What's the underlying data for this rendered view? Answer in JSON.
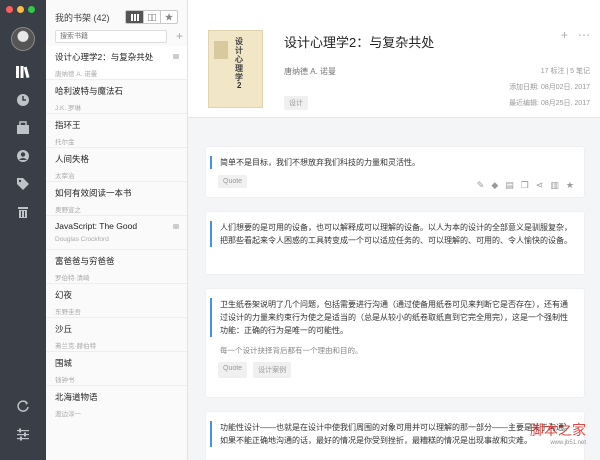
{
  "sidebar": {
    "shelf_title": "我的书架 (42)",
    "search_placeholder": "搜索书籍",
    "books": [
      {
        "title": "设计心理学2：与复杂共处",
        "author": "唐纳德 A. 诺曼",
        "has_note": true
      },
      {
        "title": "哈利波特与魔法石",
        "author": "J.K. 罗琳",
        "has_note": false
      },
      {
        "title": "指环王",
        "author": "托尔金",
        "has_note": false
      },
      {
        "title": "人间失格",
        "author": "太宰治",
        "has_note": false
      },
      {
        "title": "如何有效阅读一本书",
        "author": "奥野宣之",
        "has_note": false
      },
      {
        "title": "JavaScript: The Good",
        "author": "Douglas Crockford",
        "has_note": true
      },
      {
        "title": "富爸爸与穷爸爸",
        "author": "罗伯特·清崎",
        "has_note": false
      },
      {
        "title": "幻夜",
        "author": "东野圭吾",
        "has_note": false
      },
      {
        "title": "沙丘",
        "author": "弗兰克·赫伯特",
        "has_note": false
      },
      {
        "title": "围城",
        "author": "钱钟书",
        "has_note": false
      },
      {
        "title": "北海道物语",
        "author": "渡边淳一",
        "has_note": false
      }
    ]
  },
  "book": {
    "title": "设计心理学2：与复杂共处",
    "author": "唐纳德 A. 诺曼",
    "tag": "设计",
    "counts": "17 标注 | 5 笔记",
    "added": "添加日期: 08月02日, 2017",
    "updated": "最近编辑: 08月25日, 2017",
    "cover_title": "设计心理学",
    "cover_number": "2"
  },
  "quotes": [
    {
      "text": "简单不是目标，我们不想放弃我们科技的力量和灵活性。",
      "note": "",
      "tags": [
        "Quote"
      ]
    },
    {
      "text": "人们想要的是可用的设备，也可以解释成可以理解的设备。以人为本的设计的全部意义是驯服复杂，把那些看起来令人困惑的工具转变成一个可以适应任务的、可以理解的、可用的、令人愉快的设备。",
      "note": "",
      "tags": []
    },
    {
      "text": "卫生纸卷架说明了几个问题，包括需要进行沟通（通过使备用纸卷可见来判断它是否存在），还有通过设计的力量来约束行为使之是适当的（总是从较小的纸卷取纸直到它完全用完），这是一个强制性功能：正确的行为是唯一的可能性。",
      "note": "每一个设计抉择背后都有一个理由和目的。",
      "tags": [
        "Quote",
        "设计案例"
      ]
    },
    {
      "text": "功能性设计——也就是在设计中使我们周围的对象可用并可以理解的那一部分——主要是关于沟通。如果不能正确地沟通的话，最好的情况是你受到挫折，最糟糕的情况是出现事故和灾难。",
      "note": "",
      "tags": []
    }
  ],
  "watermark": {
    "main": "脚本之家",
    "sub": "www.jb51.net"
  },
  "colors": {
    "rail": "#3a3e46",
    "accent": "#4a90e2",
    "close": "#fc605c",
    "minimize": "#fdbc40",
    "zoom": "#34c84a"
  }
}
